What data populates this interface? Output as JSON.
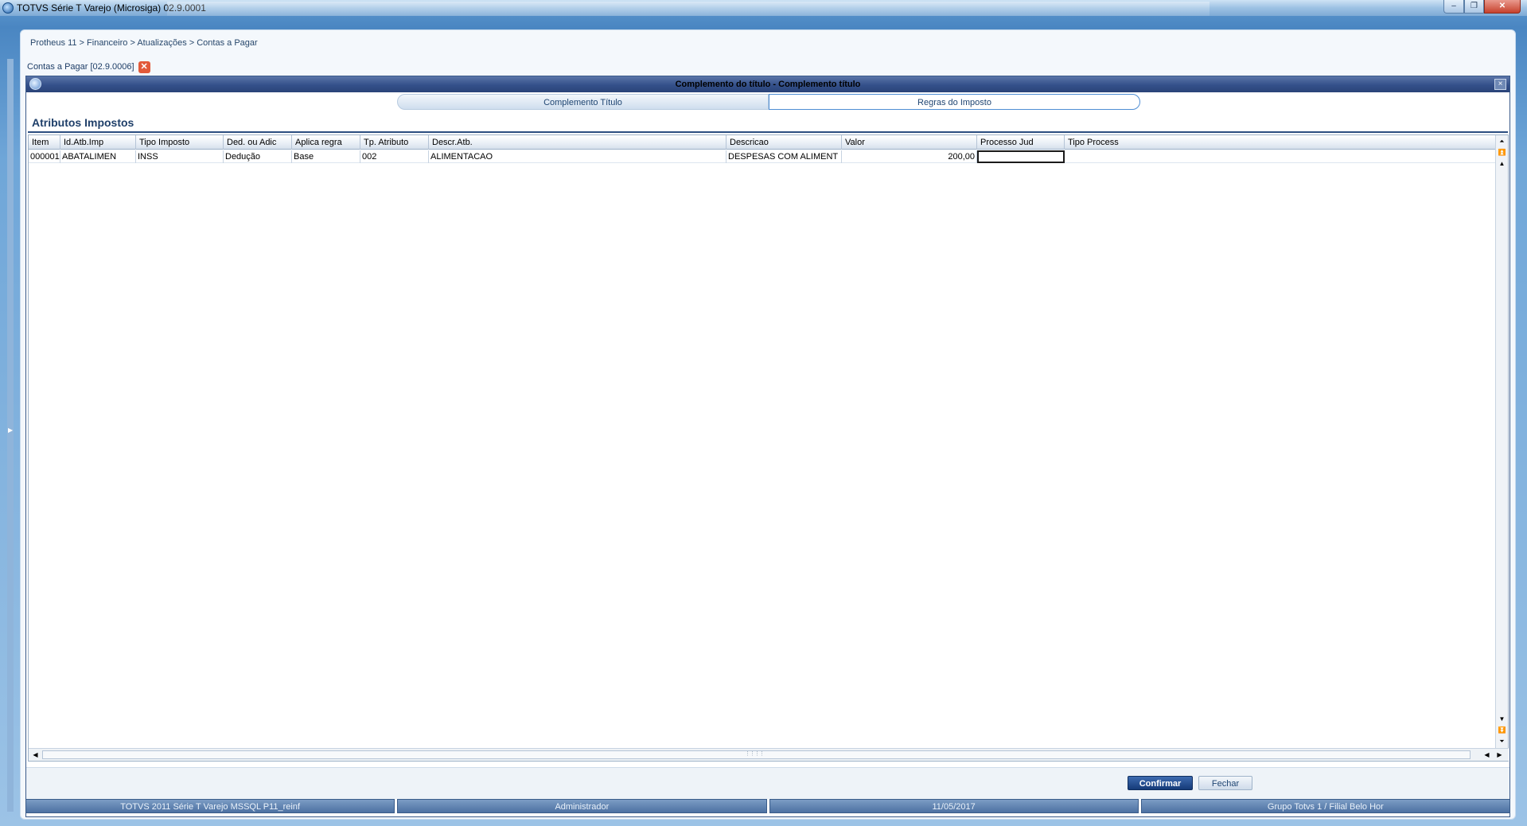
{
  "window": {
    "title": "TOTVS Série T Varejo (Microsiga) 02.9.0001",
    "controls": {
      "minimize": "–",
      "maximize": "❐",
      "close": "✕"
    }
  },
  "breadcrumb": "Protheus 11 > Financeiro > Atualizações > Contas a Pagar",
  "doc_tab": {
    "label": "Contas a Pagar [02.9.0006]",
    "close": "✕"
  },
  "dialog": {
    "title": "Complemento do título - Complemento título",
    "close": "×",
    "tabs": [
      {
        "label": "Complemento Título",
        "active": false
      },
      {
        "label": "Regras do Imposto",
        "active": true
      }
    ],
    "section_title": "Atributos Impostos",
    "grid": {
      "columns": [
        "Item",
        "Id.Atb.Imp",
        "Tipo Imposto",
        "Ded. ou Adic",
        "Aplica regra",
        "Tp. Atributo",
        "Descr.Atb.",
        "Descricao",
        "Valor",
        "Processo Jud",
        "Tipo Process"
      ],
      "rows": [
        [
          "000001",
          "ABATALIMEN",
          "INSS",
          "Dedução",
          "Base",
          "002",
          "ALIMENTACAO",
          "DESPESAS COM ALIMENT",
          "200,00",
          "",
          ""
        ]
      ]
    },
    "buttons": {
      "confirm": "Confirmar",
      "close": "Fechar"
    }
  },
  "statusbar": [
    "TOTVS 2011 Série T Varejo MSSQL P11_reinf",
    "Administrador",
    "11/05/2017",
    "Grupo Totvs 1 / Filial Belo Hor"
  ],
  "colors": {
    "header_blue": "#34508a",
    "confirm_button": "#153a78",
    "tab_active_border": "#4f8ed4"
  }
}
